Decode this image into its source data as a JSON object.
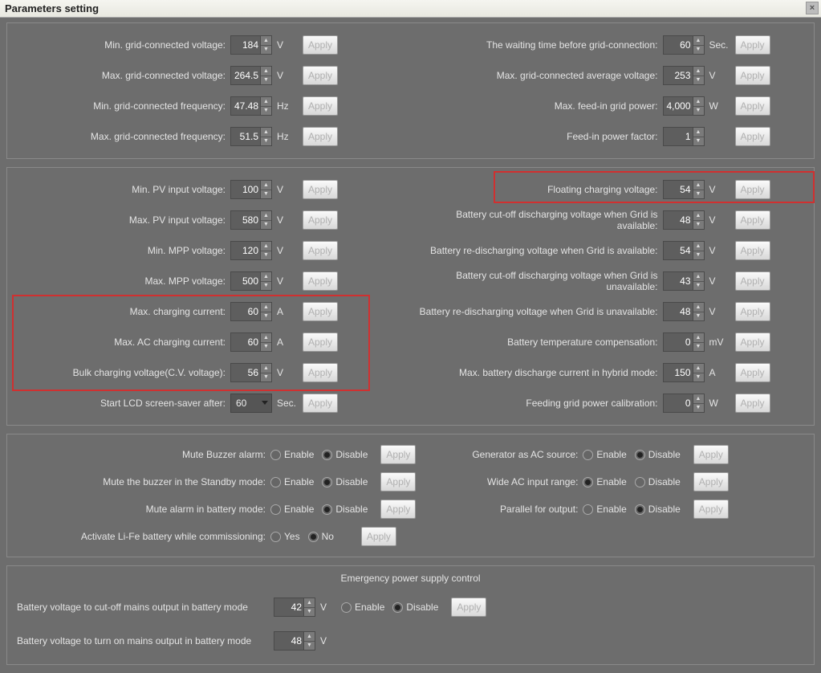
{
  "window": {
    "title": "Parameters setting",
    "apply": "Apply"
  },
  "units": {
    "v": "V",
    "hz": "Hz",
    "sec": "Sec.",
    "w": "W",
    "a": "A",
    "mv": "mV"
  },
  "radios": {
    "enable": "Enable",
    "disable": "Disable",
    "yes": "Yes",
    "no": "No"
  },
  "top": {
    "left": [
      {
        "label": "Min. grid-connected voltage:",
        "value": "184",
        "unit": "v"
      },
      {
        "label": "Max. grid-connected voltage:",
        "value": "264.5",
        "unit": "v"
      },
      {
        "label": "Min. grid-connected frequency:",
        "value": "47.48",
        "unit": "hz"
      },
      {
        "label": "Max. grid-connected frequency:",
        "value": "51.5",
        "unit": "hz"
      }
    ],
    "right": [
      {
        "label": "The waiting time before grid-connection:",
        "value": "60",
        "unit": "sec"
      },
      {
        "label": "Max. grid-connected average voltage:",
        "value": "253",
        "unit": "v"
      },
      {
        "label": "Max. feed-in grid power:",
        "value": "4,000",
        "unit": "w"
      },
      {
        "label": "Feed-in power factor:",
        "value": "1",
        "unit": ""
      }
    ]
  },
  "mid": {
    "left": [
      {
        "label": "Min. PV input voltage:",
        "value": "100",
        "unit": "v"
      },
      {
        "label": "Max. PV input voltage:",
        "value": "580",
        "unit": "v"
      },
      {
        "label": "Min. MPP voltage:",
        "value": "120",
        "unit": "v"
      },
      {
        "label": "Max. MPP voltage:",
        "value": "500",
        "unit": "v"
      },
      {
        "label": "Max. charging current:",
        "value": "60",
        "unit": "a"
      },
      {
        "label": "Max. AC charging current:",
        "value": "60",
        "unit": "a"
      },
      {
        "label": "Bulk charging voltage(C.V. voltage):",
        "value": "56",
        "unit": "v"
      }
    ],
    "lcd": {
      "label": "Start LCD screen-saver after:",
      "value": "60",
      "unit": "sec"
    },
    "right": [
      {
        "label": "Floating charging voltage:",
        "value": "54",
        "unit": "v"
      },
      {
        "label": "Battery cut-off discharging voltage when Grid is available:",
        "value": "48",
        "unit": "v"
      },
      {
        "label": "Battery re-discharging voltage when Grid is available:",
        "value": "54",
        "unit": "v"
      },
      {
        "label": "Battery cut-off discharging voltage when Grid is unavailable:",
        "value": "43",
        "unit": "v"
      },
      {
        "label": "Battery re-discharging voltage when Grid is unavailable:",
        "value": "48",
        "unit": "v"
      },
      {
        "label": "Battery temperature compensation:",
        "value": "0",
        "unit": "mv"
      },
      {
        "label": "Max. battery discharge current in hybrid mode:",
        "value": "150",
        "unit": "a"
      },
      {
        "label": "Feeding grid power calibration:",
        "value": "0",
        "unit": "w"
      }
    ]
  },
  "toggles": {
    "left": [
      {
        "label": "Mute Buzzer alarm:",
        "selected": "disable"
      },
      {
        "label": "Mute the buzzer in the Standby mode:",
        "selected": "disable"
      },
      {
        "label": "Mute alarm in battery mode:",
        "selected": "disable"
      }
    ],
    "life": {
      "label": "Activate Li-Fe battery while commissioning:",
      "selected": "no"
    },
    "right": [
      {
        "label": "Generator as AC source:",
        "selected": "disable"
      },
      {
        "label": "Wide AC input range:",
        "selected": "enable"
      },
      {
        "label": "Parallel for output:",
        "selected": "disable"
      }
    ]
  },
  "emergency": {
    "title": "Emergency power supply control",
    "row1": {
      "label": "Battery voltage to cut-off mains output in battery mode",
      "value": "42",
      "unit": "v",
      "selected": "disable"
    },
    "row2": {
      "label": "Battery voltage to turn on mains output in battery mode",
      "value": "48",
      "unit": "v"
    }
  }
}
